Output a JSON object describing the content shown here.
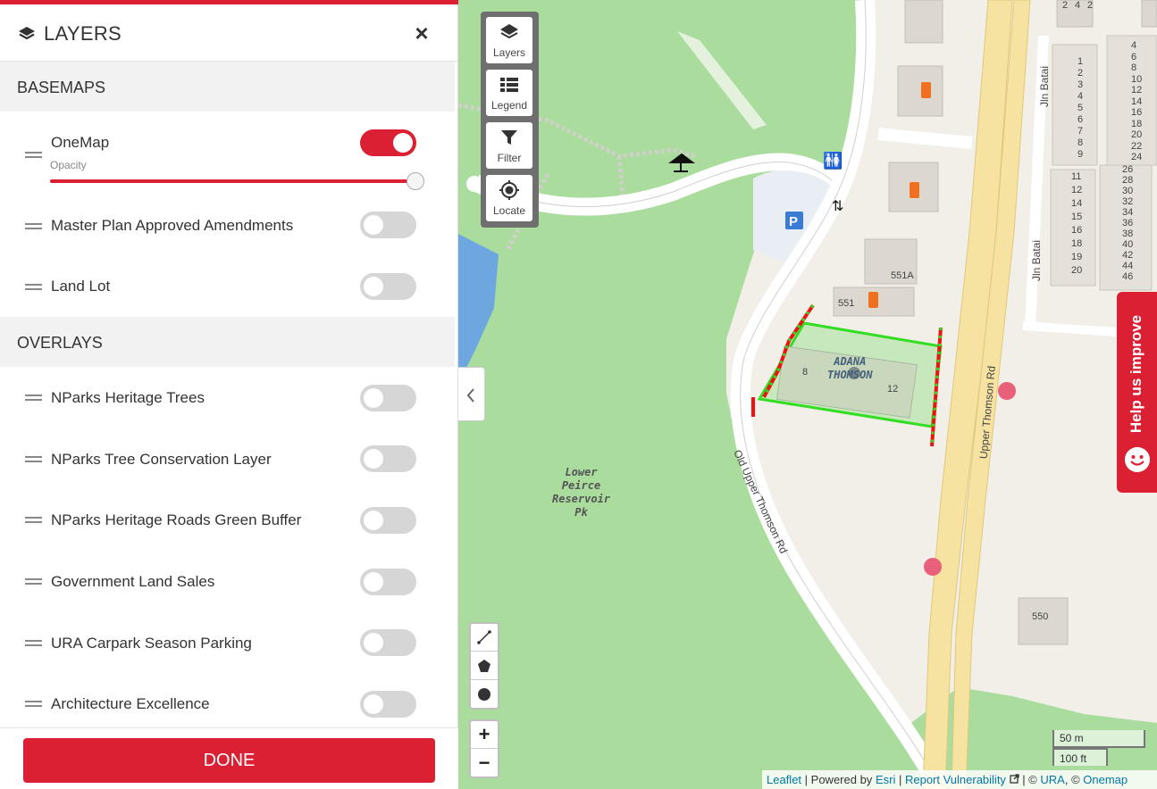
{
  "panel": {
    "title": "LAYERS",
    "close_label": "×",
    "basemaps_heading": "BASEMAPS",
    "overlays_heading": "OVERLAYS",
    "opacity_label": "Opacity",
    "opacity_value": 1.0,
    "basemaps": [
      {
        "label": "OneMap",
        "enabled": true
      },
      {
        "label": "Master Plan Approved Amendments",
        "enabled": false
      },
      {
        "label": "Land Lot",
        "enabled": false
      }
    ],
    "overlays": [
      {
        "label": "NParks Heritage Trees",
        "enabled": false
      },
      {
        "label": "NParks Tree Conservation Layer",
        "enabled": false
      },
      {
        "label": "NParks Heritage Roads Green Buffer",
        "enabled": false
      },
      {
        "label": "Government Land Sales",
        "enabled": false
      },
      {
        "label": "URA Carpark Season Parking",
        "enabled": false
      },
      {
        "label": "Architecture Excellence",
        "enabled": false
      }
    ],
    "done_label": "DONE"
  },
  "map_tools": {
    "layers": "Layers",
    "legend": "Legend",
    "filter": "Filter",
    "locate": "Locate"
  },
  "zoom": {
    "in": "+",
    "out": "−"
  },
  "scale": {
    "metric": "50 m",
    "imperial": "100 ft"
  },
  "attribution": {
    "leaflet": "Leaflet",
    "powered_by": "| Powered by",
    "esri": "Esri",
    "report": "Report Vulnerability",
    "copyright_ura": "| ©",
    "ura": "URA",
    "copyright_onemap": ", ©",
    "onemap": "Onemap"
  },
  "help_tab": "Help us improve",
  "map_labels": {
    "park": "Lower\nPeirce\nReservoir\nPk",
    "site": "ADANA\nTHOMSON",
    "road_old": "Old Upper Thomson Rd",
    "road_main": "Upper Thomson Rd",
    "jln_batai_1": "Jln Batai",
    "jln_batai_2": "Jln Batai",
    "bldg_551": "551",
    "bldg_551a": "551A",
    "bldg_550": "550",
    "bldg_8": "8",
    "bldg_12": "12"
  },
  "house_numbers": {
    "col_a": [
      "1",
      "2",
      "3",
      "4",
      "5",
      "6",
      "7",
      "8",
      "9"
    ],
    "col_b": [
      "4",
      "6",
      "8",
      "10",
      "12",
      "14",
      "16",
      "18",
      "20",
      "22",
      "24"
    ],
    "col_c": [
      "11",
      "12",
      "14",
      "15",
      "16",
      "18",
      "19",
      "20"
    ],
    "col_d": [
      "26",
      "28",
      "30",
      "32",
      "34",
      "36",
      "38",
      "40",
      "42",
      "44",
      "46"
    ],
    "top": [
      "2",
      "4",
      "2"
    ]
  },
  "colors": {
    "accent": "#dc2033",
    "park_green": "#a9dc9d",
    "road_yellow": "#f6e3a2",
    "water": "#6ea7e0"
  }
}
